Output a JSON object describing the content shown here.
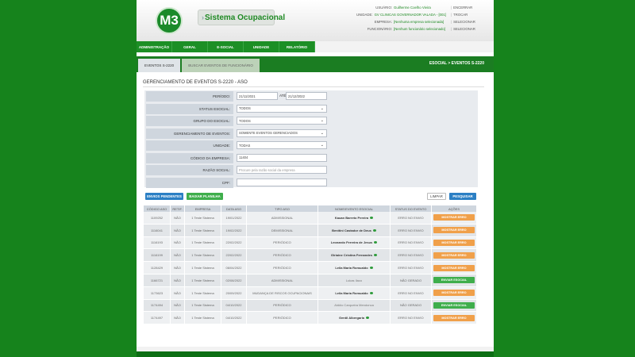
{
  "header": {
    "logo": "M3",
    "app_title": "Sistema Ocupacional",
    "info": [
      {
        "label": "USUÁRIO:",
        "value": "Guilherme Coelho Vieira",
        "link": "ENCERRAR"
      },
      {
        "label": "UNIDADE:",
        "value": "GV CLINICAS GOVERNADOR VALADA - [001]",
        "link": "TROCAR"
      },
      {
        "label": "EMPRESA:",
        "value": "[Nenhuma empresa selecionada]",
        "link": "SELECIONAR"
      },
      {
        "label": "FUNCIONÁRIO:",
        "value": "[Nenhum funcionário selecionado]",
        "link": "SELECIONAR"
      }
    ]
  },
  "menu": [
    "ADMINISTRAÇÃO",
    "GERAL",
    "E-SOCIAL",
    "UNIDADE",
    "RELATÓRIO"
  ],
  "subtabs": [
    {
      "label": "EVENTOS S-2220",
      "active": true
    },
    {
      "label": "BUSCAR EVENTOS DE FUNCIONÁRIO",
      "active": false
    }
  ],
  "breadcrumb": "ESOCIAL > EVENTOS S-2220",
  "section_title": "GERENCIAMENTO DE EVENTOS S-2220 - ASO",
  "filters": {
    "periodo_label": "PERÍODO:",
    "periodo_inicio": "21/11/2021",
    "ate_label": "ATÉ",
    "periodo_fim": "21/12/2022",
    "status_label": "STATUS ESOCIAL:",
    "status_value": "TODOS",
    "grupo_label": "GRUPO DO ESOCIAL:",
    "grupo_value": "TODOS",
    "gerenciamento_label": "GERENCIAMENTO DE EVENTOS:",
    "gerenciamento_value": "SOMENTE EVENTOS GERENCIADOS",
    "unidade_label": "UNIDADE:",
    "unidade_value": "TODAS",
    "codigo_label": "CÓDIGO DA EMPRESA:",
    "codigo_value": "11404",
    "razao_label": "RAZÃO SOCIAL:",
    "razao_placeholder": "Procure pela razão social da empresa",
    "cpf_label": "CPF:"
  },
  "buttons": {
    "envios_pendentes": "ENVIOS PENDENTES",
    "baixar_planilha": "BAIXAR PLANILHA",
    "limpar": "LIMPAR",
    "pesquisar": "PESQUISAR"
  },
  "table": {
    "headers": [
      "CÓDIGO ASO",
      "RETIF.",
      "EMPRESA",
      "DATA ASO",
      "TIPO ASO",
      "NOME/EVENTO ESOCIAL",
      "STATUS DO EVENTO",
      "AÇÕES"
    ],
    "rows": [
      {
        "codigo": "1109252",
        "retif": "NÃO",
        "empresa": "1 Teste Sistema",
        "data": "19/01/2022",
        "tipo": "ADMISSIONAL",
        "nome": "Kauan Barreto Pereira",
        "status": "ERRO NO ENVIO",
        "acao": "MOSTRAR ERRO",
        "acao_type": "orange",
        "bold": true
      },
      {
        "codigo": "1116041",
        "retif": "NÃO",
        "empresa": "1 Teste Sistema",
        "data": "19/02/2022",
        "tipo": "DEMISSIONAL",
        "nome": "Benitini Castador de Deus",
        "status": "ERRO NO ENVIO",
        "acao": "MOSTRAR ERRO",
        "acao_type": "orange",
        "bold": true
      },
      {
        "codigo": "1116193",
        "retif": "NÃO",
        "empresa": "1 Teste Sistema",
        "data": "22/02/2022",
        "tipo": "PERIÓDICO",
        "nome": "Leonardo Ferreira de Jesus",
        "status": "ERRO NO ENVIO",
        "acao": "MOSTRAR ERRO",
        "acao_type": "orange",
        "bold": true
      },
      {
        "codigo": "1116199",
        "retif": "NÃO",
        "empresa": "1 Teste Sistema",
        "data": "22/02/2022",
        "tipo": "PERIÓDICO",
        "nome": "Glriaine Cristina Fernandes",
        "status": "ERRO NO ENVIO",
        "acao": "MOSTRAR ERRO",
        "acao_type": "orange",
        "bold": true
      },
      {
        "codigo": "1128429",
        "retif": "NÃO",
        "empresa": "1 Teste Sistema",
        "data": "06/04/2022",
        "tipo": "PERIÓDICO",
        "nome": "Leila Maria Romualdo",
        "status": "ERRO NO ENVIO",
        "acao": "MOSTRAR ERRO",
        "acao_type": "orange",
        "bold": true
      },
      {
        "codigo": "1166721",
        "retif": "NÃO",
        "empresa": "1 Teste Sistema",
        "data": "02/08/2022",
        "tipo": "ADMISSIONAL",
        "nome": "Lukas Ilaco",
        "status": "NÃO GERADO",
        "acao": "ENVIAR ESOCIAL",
        "acao_type": "green",
        "bold": false
      },
      {
        "codigo": "1173623",
        "retif": "NÃO",
        "empresa": "1 Teste Sistema",
        "data": "20/09/2022",
        "tipo": "MUDANÇA DE RISCOS OCUPACIONAIS",
        "nome": "Leila Maria Romualdo",
        "status": "ERRO NO ENVIO",
        "acao": "MOSTRAR ERRO",
        "acao_type": "orange",
        "bold": true
      },
      {
        "codigo": "1174494",
        "retif": "NÃO",
        "empresa": "1 Teste Sistema",
        "data": "04/10/2022",
        "tipo": "PERIÓDICO",
        "nome": "Aldôio Carqueira Mendonca",
        "status": "NÃO GERADO",
        "acao": "ENVIAR ESOCIAL",
        "acao_type": "green",
        "bold": false
      },
      {
        "codigo": "1174497",
        "retif": "NÃO",
        "empresa": "1 Teste Sistema",
        "data": "04/10/2022",
        "tipo": "PERIÓDICO",
        "nome": "Gentil Albergaria",
        "status": "ERRO NO ENVIO",
        "acao": "MOSTRAR ERRO",
        "acao_type": "orange",
        "bold": true
      }
    ]
  },
  "colors": {
    "brand_green": "#16831c",
    "button_blue": "#2b7fc4",
    "action_orange": "#f0a04a",
    "action_green": "#3fae4c"
  }
}
